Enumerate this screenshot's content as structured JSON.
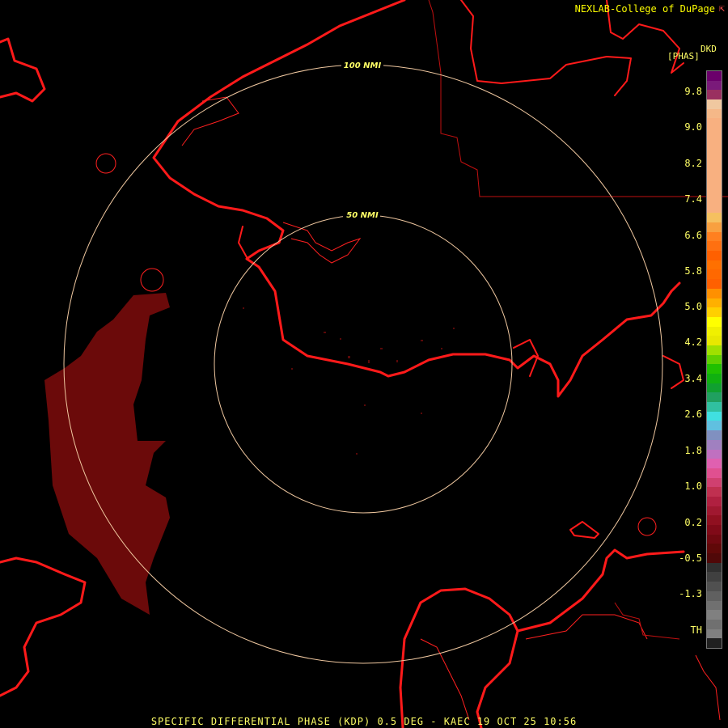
{
  "header": {
    "credit": "NEXLAB-College of DuPage",
    "product_code": "DKD",
    "unit": "[PHAS]"
  },
  "range_rings": [
    {
      "label": "100 NMI"
    },
    {
      "label": "50 NMI"
    }
  ],
  "legend": {
    "labels": [
      "9.8",
      "9.0",
      "8.2",
      "7.4",
      "6.6",
      "5.8",
      "5.0",
      "4.2",
      "3.4",
      "2.6",
      "1.8",
      "1.0",
      "0.2",
      "-0.5",
      "-1.3",
      "TH"
    ]
  },
  "caption": "SPECIFIC DIFFERENTIAL PHASE (KDP) 0.5 DEG - KAEC 19 OCT 25 10:56",
  "colors": {
    "background": "#000000",
    "map_lines": "#ff1a1a",
    "range_rings": "#f0c8a0",
    "echo": "#6b0a0a",
    "text": "#ffff66"
  }
}
